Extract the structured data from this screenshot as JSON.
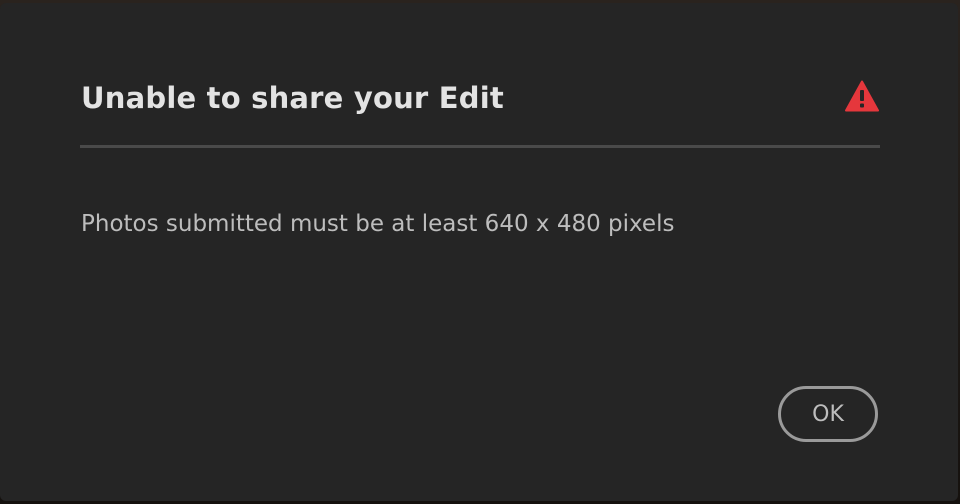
{
  "dialog": {
    "title": "Unable to share your Edit",
    "message": "Photos submitted must be at least 640 x 480 pixels",
    "ok_label": "OK",
    "icon": "alert-triangle-icon",
    "icon_color": "#e5373c"
  },
  "colors": {
    "dialog_background": "#252525",
    "title_text": "#e3e3e3",
    "body_text": "#bdbdbd",
    "button_border": "#9a9a9a"
  }
}
